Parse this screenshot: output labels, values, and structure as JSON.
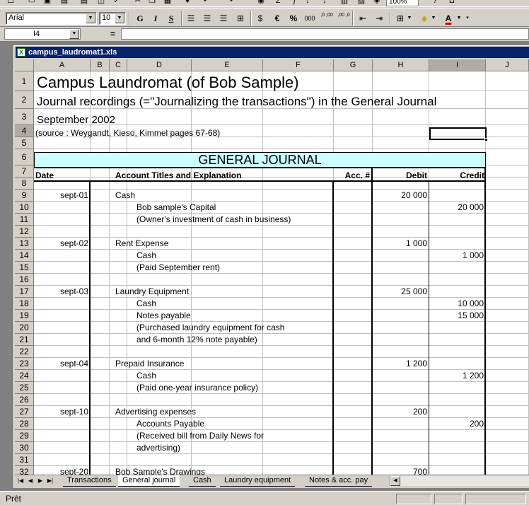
{
  "toolbar": {
    "zoom": "100%",
    "font_name": "Arial",
    "font_size": "10",
    "bold_label": "G",
    "italic_label": "I",
    "underline_label": "S",
    "euro_label": "€",
    "percent_label": "%",
    "thousands_label": "000",
    "increase_decimals_label": ",0 ,00",
    "decrease_decimals_label": ",00 ,0"
  },
  "formula_bar": {
    "name_box": "I4",
    "equals": "=",
    "formula": ""
  },
  "workbook": {
    "title": "campus_laudromat1.xls"
  },
  "columns": [
    "A",
    "B",
    "C",
    "D",
    "E",
    "F",
    "G",
    "H",
    "I",
    "J"
  ],
  "selected_column": "I",
  "rows": [
    "1",
    "2",
    "3",
    "4",
    "5",
    "6",
    "7",
    "8",
    "9",
    "10",
    "11",
    "12",
    "13",
    "14",
    "15",
    "16",
    "17",
    "18",
    "19",
    "20",
    "21",
    "22",
    "23",
    "24",
    "25",
    "26",
    "27",
    "28",
    "29",
    "30",
    "31",
    "32"
  ],
  "selected_row": "4",
  "sheet": {
    "title": "Campus Laundromat (of Bob Sample)",
    "subtitle": "Journal recordings (=\"Journalizing the transactions\") in the General Journal",
    "period": "September 2002",
    "source": "(source : Weygandt, Kieso, Kimmel pages 67-68)",
    "banner": "GENERAL JOURNAL",
    "headers": {
      "date": "Date",
      "account": "Account Titles and Explanation",
      "acc_no": "Acc. #",
      "debit": "Debit",
      "credit": "Credit"
    },
    "lines": [
      {
        "row": 9,
        "date": "sept-01",
        "account": "Cash",
        "indent": false,
        "debit": "20 000",
        "credit": ""
      },
      {
        "row": 10,
        "date": "",
        "account": "Bob sample's Capital",
        "indent": true,
        "debit": "",
        "credit": "20 000"
      },
      {
        "row": 11,
        "date": "",
        "account": "(Owner's investment of cash in business)",
        "indent": true,
        "debit": "",
        "credit": ""
      },
      {
        "row": 13,
        "date": "sept-02",
        "account": "Rent Expense",
        "indent": false,
        "debit": "1 000",
        "credit": ""
      },
      {
        "row": 14,
        "date": "",
        "account": "Cash",
        "indent": true,
        "debit": "",
        "credit": "1 000"
      },
      {
        "row": 15,
        "date": "",
        "account": "(Paid September rent)",
        "indent": true,
        "debit": "",
        "credit": ""
      },
      {
        "row": 17,
        "date": "sept-03",
        "account": "Laundry Equipment",
        "indent": false,
        "debit": "25 000",
        "credit": ""
      },
      {
        "row": 18,
        "date": "",
        "account": "Cash",
        "indent": true,
        "debit": "",
        "credit": "10 000"
      },
      {
        "row": 19,
        "date": "",
        "account": "Notes payable",
        "indent": true,
        "debit": "",
        "credit": "15 000"
      },
      {
        "row": 20,
        "date": "",
        "account": "(Purchased laundry equipment for cash",
        "indent": true,
        "debit": "",
        "credit": ""
      },
      {
        "row": 21,
        "date": "",
        "account": "and 6-month 12% note payable)",
        "indent": true,
        "debit": "",
        "credit": ""
      },
      {
        "row": 23,
        "date": "sept-04",
        "account": "Prepaid Insurance",
        "indent": false,
        "debit": "1 200",
        "credit": ""
      },
      {
        "row": 24,
        "date": "",
        "account": "Cash",
        "indent": true,
        "debit": "",
        "credit": "1 200"
      },
      {
        "row": 25,
        "date": "",
        "account": "(Paid one-year insurance policy)",
        "indent": true,
        "debit": "",
        "credit": ""
      },
      {
        "row": 27,
        "date": "sept-10",
        "account": "Advertising expenses",
        "indent": false,
        "debit": "200",
        "credit": ""
      },
      {
        "row": 28,
        "date": "",
        "account": "Accounts Payable",
        "indent": true,
        "debit": "",
        "credit": "200"
      },
      {
        "row": 29,
        "date": "",
        "account": "(Received bill from Daily News for",
        "indent": true,
        "debit": "",
        "credit": ""
      },
      {
        "row": 30,
        "date": "",
        "account": "advertising)",
        "indent": true,
        "debit": "",
        "credit": ""
      },
      {
        "row": 32,
        "date": "sept-20",
        "account": "Bob Sample's Drawings",
        "indent": false,
        "debit": "700",
        "credit": ""
      }
    ]
  },
  "tabs": [
    "Transactions",
    "General journal",
    "Cash",
    "Laundry equipment",
    "Notes & acc. pay"
  ],
  "active_tab": "General journal",
  "status": {
    "text": "Prêt"
  },
  "colors": {
    "banner_bg": "#ccffff",
    "title_bar": "#0a246a"
  }
}
